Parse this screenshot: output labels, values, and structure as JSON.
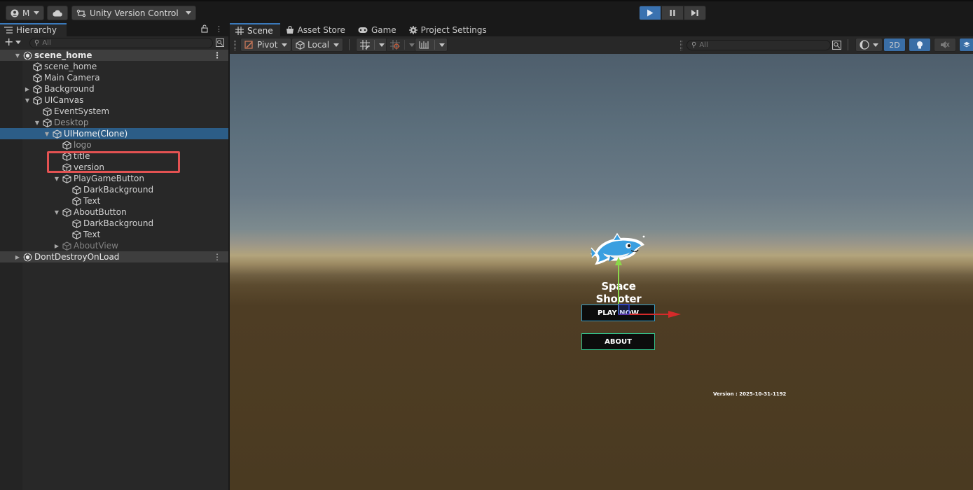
{
  "toolbar": {
    "account_label": "M",
    "version_control_label": "Unity Version Control"
  },
  "hierarchy": {
    "tab_label": "Hierarchy",
    "search_placeholder": "All",
    "rows": [
      {
        "label": "scene_home",
        "depth": 0,
        "arrow": "down",
        "type": "scene"
      },
      {
        "label": "scene_home",
        "depth": 1,
        "arrow": "none",
        "type": "obj"
      },
      {
        "label": "Main Camera",
        "depth": 1,
        "arrow": "none",
        "type": "obj"
      },
      {
        "label": "Background",
        "depth": 1,
        "arrow": "right",
        "type": "obj"
      },
      {
        "label": "UICanvas",
        "depth": 1,
        "arrow": "down",
        "type": "obj"
      },
      {
        "label": "EventSystem",
        "depth": 2,
        "arrow": "none",
        "type": "obj"
      },
      {
        "label": "Desktop",
        "depth": 2,
        "arrow": "down",
        "type": "obj"
      },
      {
        "label": "UIHome(Clone)",
        "depth": 3,
        "arrow": "down",
        "type": "obj",
        "selected": true
      },
      {
        "label": "logo",
        "depth": 4,
        "arrow": "none",
        "type": "obj"
      },
      {
        "label": "title",
        "depth": 4,
        "arrow": "none",
        "type": "obj"
      },
      {
        "label": "version",
        "depth": 4,
        "arrow": "none",
        "type": "obj"
      },
      {
        "label": "PlayGameButton",
        "depth": 4,
        "arrow": "down",
        "type": "obj"
      },
      {
        "label": "DarkBackground",
        "depth": 5,
        "arrow": "none",
        "type": "obj"
      },
      {
        "label": "Text",
        "depth": 5,
        "arrow": "none",
        "type": "obj"
      },
      {
        "label": "AboutButton",
        "depth": 4,
        "arrow": "down",
        "type": "obj"
      },
      {
        "label": "DarkBackground",
        "depth": 5,
        "arrow": "none",
        "type": "obj"
      },
      {
        "label": "Text",
        "depth": 5,
        "arrow": "none",
        "type": "obj"
      },
      {
        "label": "AboutView",
        "depth": 4,
        "arrow": "right",
        "type": "obj",
        "dim": true
      },
      {
        "label": "DontDestroyOnLoad",
        "depth": 0,
        "arrow": "right",
        "type": "scene2"
      }
    ]
  },
  "scene_tabs": [
    {
      "label": "Scene",
      "icon": "grid-icon",
      "active": true
    },
    {
      "label": "Asset Store",
      "icon": "store-icon"
    },
    {
      "label": "Game",
      "icon": "gamepad-icon"
    },
    {
      "label": "Project Settings",
      "icon": "gear-icon"
    }
  ],
  "scene_toolbar": {
    "pivot_label": "Pivot",
    "local_label": "Local",
    "search_placeholder": "All",
    "two_d_label": "2D"
  },
  "game_ui": {
    "title": "Space Shooter",
    "play_button": "PLAY NOW",
    "about_button": "ABOUT",
    "version_text": "Version : 2025-10-31-1192"
  },
  "colors": {
    "accent": "#3a79bb",
    "selection": "#2c5d87",
    "highlight_box": "#e35252",
    "play_border": "#3aa1c9",
    "about_border": "#34c28a"
  }
}
